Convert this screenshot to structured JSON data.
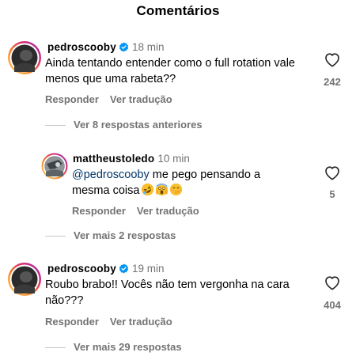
{
  "header": {
    "title": "Comentários"
  },
  "comments": [
    {
      "username": "pedroscooby",
      "verified": true,
      "time": "18 min",
      "text": "Ainda tentando entender como o full rotation vale menos que uma rabeta??",
      "likes": "242",
      "reply_label": "Responder",
      "translate_label": "Ver tradução",
      "replies_link": "Ver 8 respostas anteriores"
    },
    {
      "username": "mattheustoledo",
      "verified": false,
      "time": "10 min",
      "mention": "@pedroscooby",
      "text_line1": " me pego pensando a",
      "text_line2": "mesma coisa",
      "likes": "5",
      "reply_label": "Responder",
      "translate_label": "Ver tradução",
      "replies_link": "Ver mais 2 respostas"
    },
    {
      "username": "pedroscooby",
      "verified": true,
      "time": "19 min",
      "text": "Roubo brabo!! Vocês não tem vergonha na cara não???",
      "likes": "404",
      "reply_label": "Responder",
      "translate_label": "Ver tradução",
      "replies_link": "Ver mais 29 respostas"
    }
  ],
  "icons": {
    "verified": "verified-badge-icon",
    "like": "heart-outline-icon",
    "emojis": [
      "rolling-laughing-emoji",
      "screaming-face-emoji",
      "hand-over-mouth-emoji"
    ]
  },
  "colors": {
    "secondary_text": "#737373",
    "mention": "#00376b",
    "verified": "#0095f6"
  }
}
